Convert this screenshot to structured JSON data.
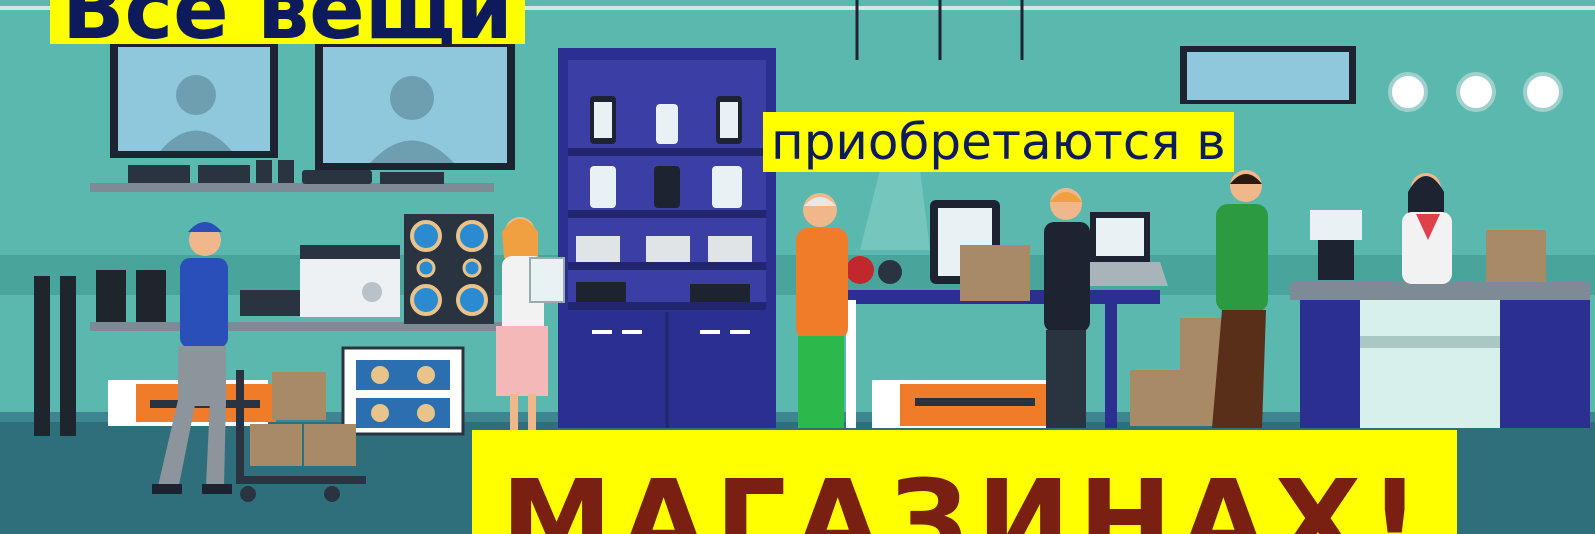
{
  "banners": {
    "top": "Все вещи",
    "middle": "приобретаются в",
    "bottom": "МАГАЗИНАХ!"
  },
  "colors": {
    "banner_bg": "#ffff00",
    "top_text": "#0d1a5c",
    "bottom_text": "#7a2012",
    "wall": "#5ab8ae",
    "floor": "#2e6f7b",
    "navy": "#2b2f8f"
  }
}
